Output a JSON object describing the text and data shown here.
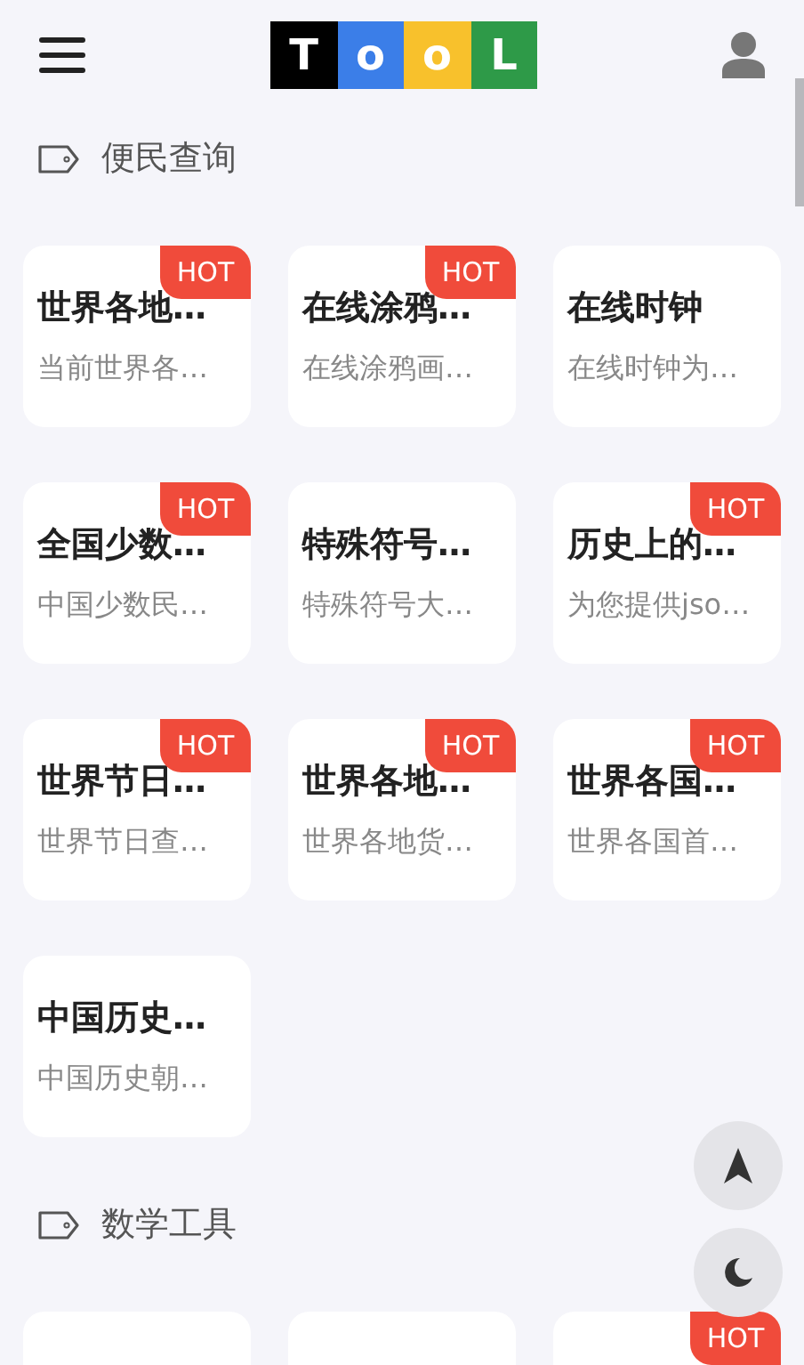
{
  "header": {
    "logo": [
      {
        "letter": "T",
        "color": "#000000"
      },
      {
        "letter": "o",
        "color": "#3b7ee8"
      },
      {
        "letter": "o",
        "color": "#f8c12c"
      },
      {
        "letter": "L",
        "color": "#2e9a48"
      }
    ]
  },
  "sections": [
    {
      "title": "便民查询",
      "tools": [
        {
          "title": "世界各地…",
          "desc": "当前世界各…",
          "badge": "HOT"
        },
        {
          "title": "在线涂鸦…",
          "desc": "在线涂鸦画…",
          "badge": "HOT"
        },
        {
          "title": "在线时钟",
          "desc": "在线时钟为…"
        },
        {
          "title": "全国少数…",
          "desc": "中国少数民…",
          "badge": "HOT"
        },
        {
          "title": "特殊符号…",
          "desc": "特殊符号大…"
        },
        {
          "title": "历史上的…",
          "desc": "为您提供jso…",
          "badge": "HOT"
        },
        {
          "title": "世界节日…",
          "desc": "世界节日查…",
          "badge": "HOT"
        },
        {
          "title": "世界各地…",
          "desc": "世界各地货…",
          "badge": "HOT"
        },
        {
          "title": "世界各国…",
          "desc": "世界各国首…",
          "badge": "HOT"
        },
        {
          "title": "中国历史…",
          "desc": "中国历史朝…"
        }
      ]
    },
    {
      "title": "数学工具",
      "tools": [
        {
          "hot": false
        },
        {
          "hot": false
        },
        {
          "hot": true,
          "badge": "HOT"
        }
      ]
    }
  ]
}
